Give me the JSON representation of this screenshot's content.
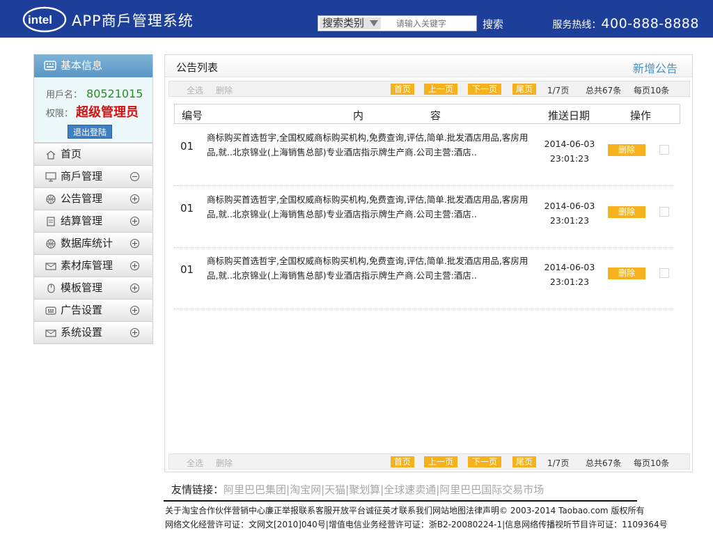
{
  "header": {
    "logo_text": "intel",
    "app_title": "APP商戶管理系统",
    "search_category": "搜索类别",
    "search_placeholder": "请输入关键字",
    "search_button": "搜索",
    "hotline_label": "服务热线：",
    "hotline_number": "400-888-8888",
    "header_color": "#1d3f99"
  },
  "sidebar": {
    "title": "基本信息",
    "username_label": "用戶名：",
    "username": "80521015",
    "role_label": "权限：",
    "role": "超级管理员",
    "logout_label": "退出登陆",
    "menu": [
      {
        "label": "首页",
        "icon": "home-icon",
        "toggle": "none"
      },
      {
        "label": "商戶管理",
        "icon": "monitor-icon",
        "toggle": "minus"
      },
      {
        "label": "公告管理",
        "icon": "globe-icon",
        "toggle": "plus"
      },
      {
        "label": "结算管理",
        "icon": "document-icon",
        "toggle": "plus"
      },
      {
        "label": "数据库统计",
        "icon": "globe-icon",
        "toggle": "plus"
      },
      {
        "label": "素材库管理",
        "icon": "mail-icon",
        "toggle": "plus"
      },
      {
        "label": "模板管理",
        "icon": "mouse-icon",
        "toggle": "plus"
      },
      {
        "label": "广告设置",
        "icon": "keyboard-icon",
        "toggle": "plus"
      },
      {
        "label": "系统设置",
        "icon": "mail-icon",
        "toggle": "plus"
      }
    ]
  },
  "main": {
    "title": "公告列表",
    "add_button": "新增公告",
    "pager": {
      "select_all": "全选",
      "delete": "删除",
      "first": "首页",
      "prev": "上一页",
      "next": "下一页",
      "last": "尾页",
      "page_info": "1/7页",
      "total": "总共67条",
      "per_page": "每页10条"
    },
    "columns": {
      "no": "编号",
      "content_1": "内",
      "content_2": "容",
      "date": "推送日期",
      "op": "操作"
    },
    "rows": [
      {
        "no": "01",
        "content": "商标购买首选哲宇,全国权威商标购买机构,免费查询,评估,简单.批发酒店用品,客房用品,就..北京锦业(上海销售总部)专业酒店指示牌生产商.公司主营:酒店..",
        "date": "2014-06-03",
        "time": "23:01:23",
        "delete": "删除"
      },
      {
        "no": "01",
        "content": "商标购买首选哲宇,全国权威商标购买机构,免费查询,评估,简单.批发酒店用品,客房用品,就..北京锦业(上海销售总部)专业酒店指示牌生产商.公司主营:酒店..",
        "date": "2014-06-03",
        "time": "23:01:23",
        "delete": "删除"
      },
      {
        "no": "01",
        "content": "商标购买首选哲宇,全国权威商标购买机构,免费查询,评估,简单.批发酒店用品,客房用品,就..北京锦业(上海销售总部)专业酒店指示牌生产商.公司主营:酒店..",
        "date": "2014-06-03",
        "time": "23:01:23",
        "delete": "删除"
      }
    ]
  },
  "footer": {
    "friends_label": "友情链接：",
    "friends_links": "阿里巴巴集团|淘宝网|天猫|聚划算|全球速卖通|阿里巴巴国际交易市场",
    "line1": "关于淘宝合作伙伴营销中心廉正举报联系客服开放平台诚征英才联系我们网站地图法律声明© 2003-2014 Taobao.com 版权所有",
    "line2": "网络文化经营许可证：文网文[2010]040号|增值电信业务经营许可证：浙B2-20080224-1|信息网络传播视听节目许可证：1109364号"
  }
}
